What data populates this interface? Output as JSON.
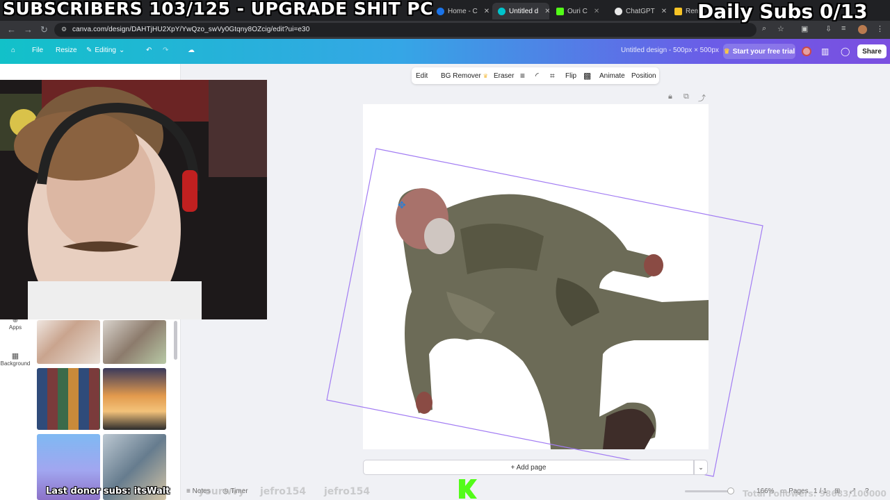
{
  "overlay": {
    "subscribers_goal": "SUBSCRIBERS 103/125 - UPGRADE SHIT PC",
    "daily_subs": "Daily Subs 0/13",
    "last_donor": "Last donor subs: itsWalt",
    "ghost_names": [
      "yourwvy",
      "jefro154",
      "jefro154"
    ],
    "total_followers": "Total Followers: 98683/100000"
  },
  "browser": {
    "tabs": [
      {
        "label": "Home - C",
        "color": "#1a73e8"
      },
      {
        "label": "Untitled d",
        "color": "#00c4cc"
      },
      {
        "label": "Ouri C",
        "color": "#53fc18"
      },
      {
        "label": "ChatGPT",
        "color": "#e8e8e8"
      },
      {
        "label": "Remo",
        "color": "#f7c325"
      }
    ],
    "url": "canva.com/design/DAHTjHU2XpY/YwQzo_swVy0Gtqny8OZcig/edit?ui=e30"
  },
  "canva": {
    "menu": {
      "file": "File",
      "resize": "Resize",
      "editing": "Editing"
    },
    "design_title": "Untitled design - 500px × 500px",
    "trial": "Start your free trial",
    "share": "Share",
    "side_rail": {
      "apps": "Apps",
      "background": "Background"
    },
    "context_toolbar": {
      "edit": "Edit",
      "bg_remover": "BG Remover",
      "eraser": "Eraser",
      "flip": "Flip",
      "animate": "Animate",
      "position": "Position"
    },
    "add_page": "+ Add page",
    "bottom": {
      "notes": "Notes",
      "timer": "Timer",
      "zoom": "166%",
      "pages_label": "Pages",
      "page_count": "1 / 1"
    }
  },
  "colors": {
    "selection_outline": "#a27cf3",
    "canva_gradient_start": "#12c1c9",
    "canva_gradient_end": "#7b4fe0",
    "kick_green": "#53fc18"
  }
}
